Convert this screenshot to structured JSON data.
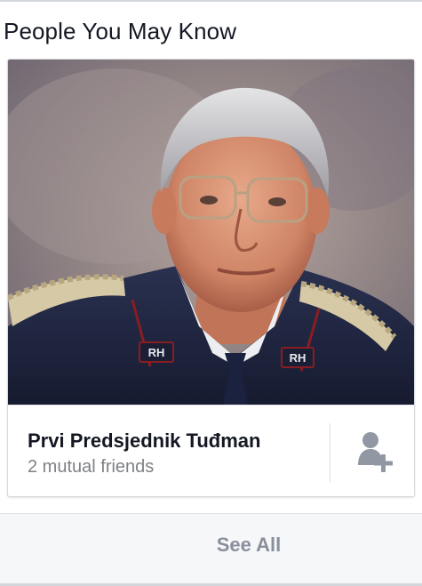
{
  "section": {
    "title": "People You May Know"
  },
  "suggestion": {
    "name": "Prvi Predsjednik Tuđman",
    "mutual_friends": "2 mutual friends",
    "uniform_insignia": "RH"
  },
  "footer": {
    "see_all_label": "See All"
  },
  "icons": {
    "add_friend": "add-friend-icon"
  },
  "colors": {
    "text_primary": "#141823",
    "text_secondary": "#7f8185",
    "see_all": "#898f9c",
    "icon": "#9197a3"
  }
}
